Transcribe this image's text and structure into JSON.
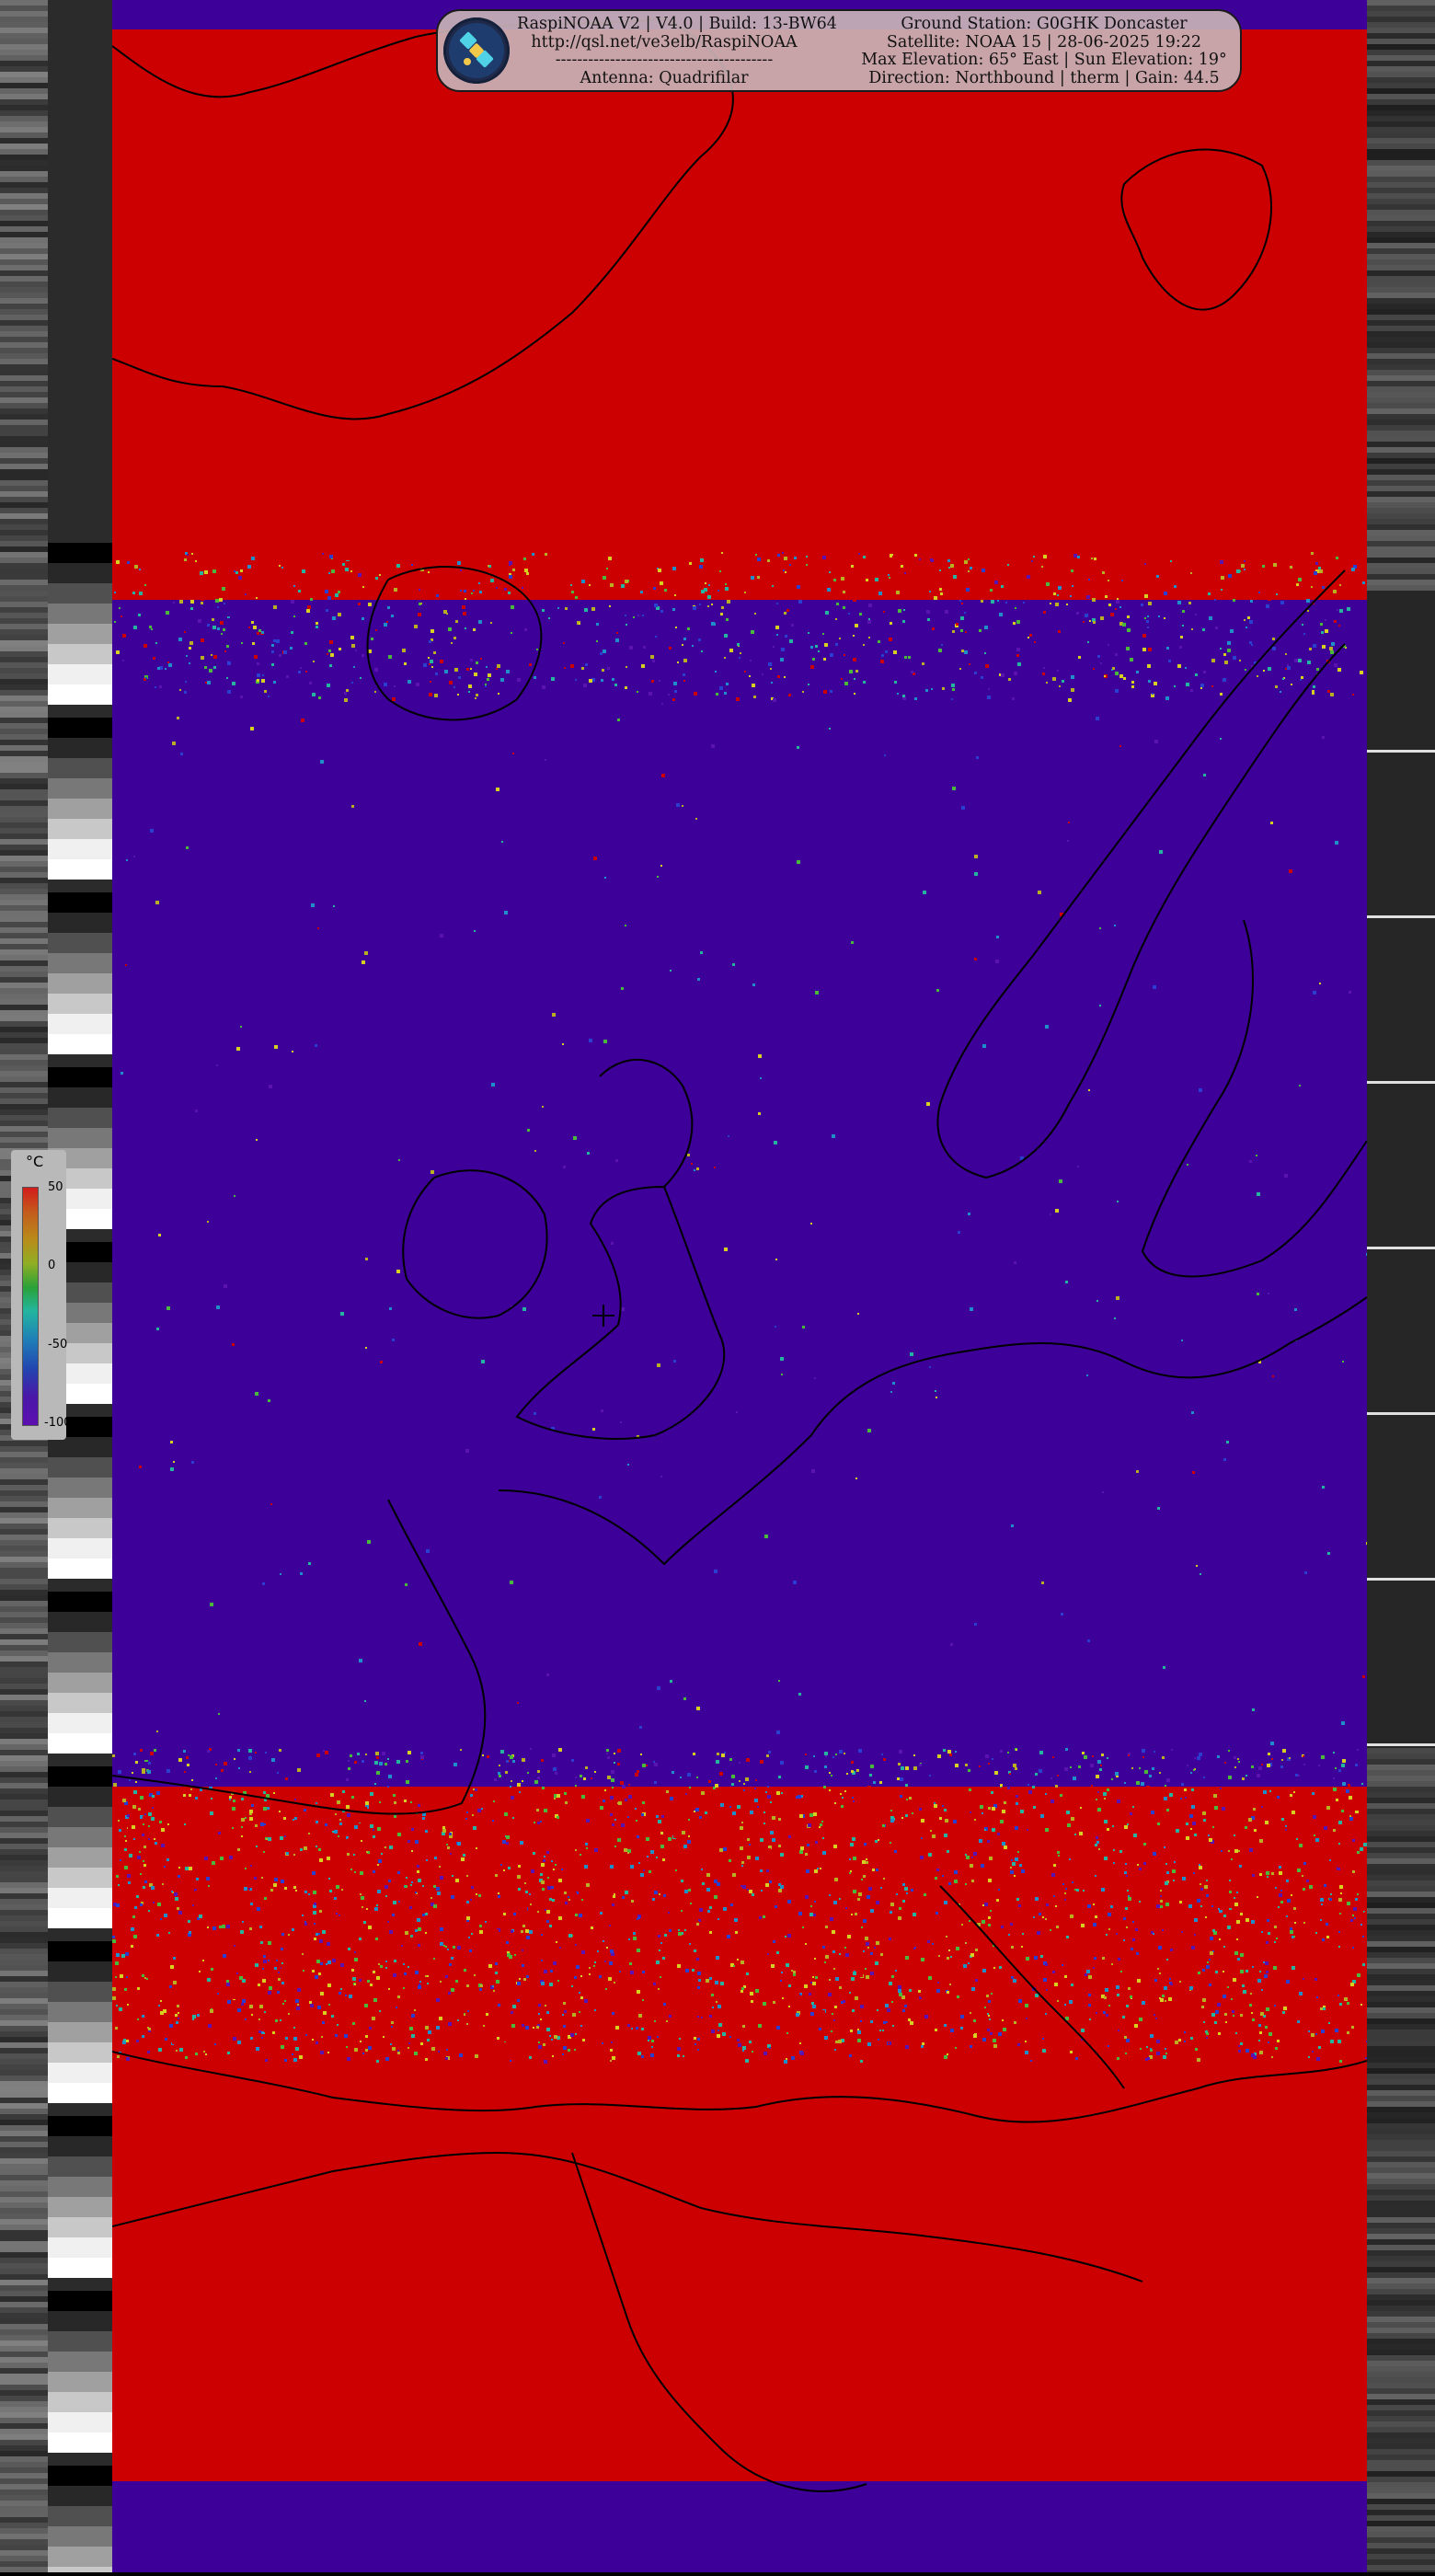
{
  "header": {
    "software": "RaspiNOAA V2 | V4.0 | Build: 13-BW64",
    "url": "http://qsl.net/ve3elb/RaspiNOAA",
    "separator": "----------------------------------------",
    "antenna": "Antenna: Quadrifilar",
    "ground_station": "Ground Station: G0GHK Doncaster",
    "satellite": "Satellite: NOAA 15 | 28-06-2025 19:22",
    "elevation": "Max Elevation: 65° East | Sun Elevation: 19°",
    "direction": "Direction: Northbound | therm | Gain: 44.5"
  },
  "logo": {
    "icon": "satellite-icon"
  },
  "legend": {
    "unit": "°C",
    "ticks": [
      "50",
      "0",
      "-50",
      "-100"
    ],
    "range": [
      -100,
      50
    ]
  },
  "colors": {
    "warm": "#cc0000",
    "cold": "#3d0099",
    "coastline": "#000000"
  },
  "map": {
    "marker_icon": "crosshair-icon"
  }
}
